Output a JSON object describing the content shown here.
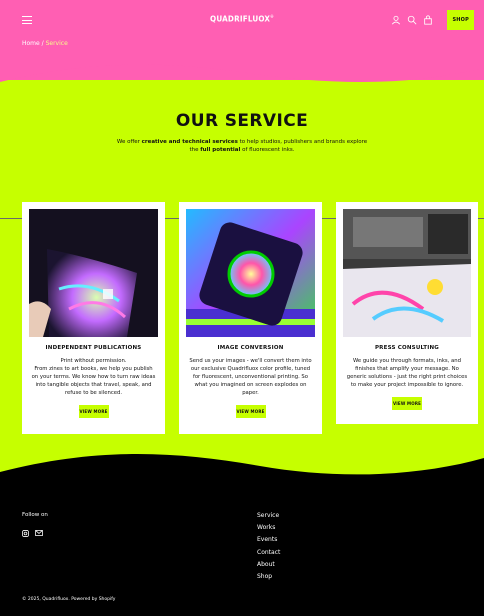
{
  "header": {
    "brand": "QUADRIFLUOX",
    "brand_mark": "®",
    "shop_label": "SHOP",
    "icons": [
      "menu-icon",
      "account-icon",
      "search-icon",
      "cart-icon"
    ]
  },
  "breadcrumb": {
    "home": "Home",
    "separator": "/",
    "current": "Service"
  },
  "hero": {
    "title": "OUR SERVICE",
    "text_1": "We offer ",
    "bold_1": "creative and technical services",
    "text_2": " to help studios, publishers and brands explore the ",
    "bold_2": "full potential",
    "text_3": " of fluorescent inks."
  },
  "cards": [
    {
      "title": "INDEPENDENT PUBLICATIONS",
      "description": "Print without permission.\nFrom zines to art books, we help you publish on your terms. We know how to turn raw ideas into tangible objects that travel, speak, and refuse to be silenced.",
      "button": "VIEW MORE"
    },
    {
      "title": "IMAGE CONVERSION",
      "description": "Send us your images - we'll convert them into our exclusive Quadrifluox color profile, tuned for fluorescent, unconventional printing. So what you imagined on screen explodes on paper.",
      "button": "VIEW MORE"
    },
    {
      "title": "PRESS CONSULTING",
      "description": "We guide you through formats, inks, and finishes that amplify your message. No generic solutions - just the right print choices to make your project impossible to ignore.",
      "button": "VIEW MORE"
    }
  ],
  "footer": {
    "follow_label": "Follow on",
    "social_icons": [
      "instagram-icon",
      "email-icon"
    ],
    "nav": [
      "Service",
      "Works",
      "Events",
      "Contact",
      "About",
      "Shop"
    ],
    "copyright": "© 2025, Quadrifluox.",
    "powered": "Powered by Shopify"
  },
  "colors": {
    "accent_lime": "#c6ff00",
    "accent_pink": "#ff5fb3",
    "footer_bg": "#000000"
  }
}
